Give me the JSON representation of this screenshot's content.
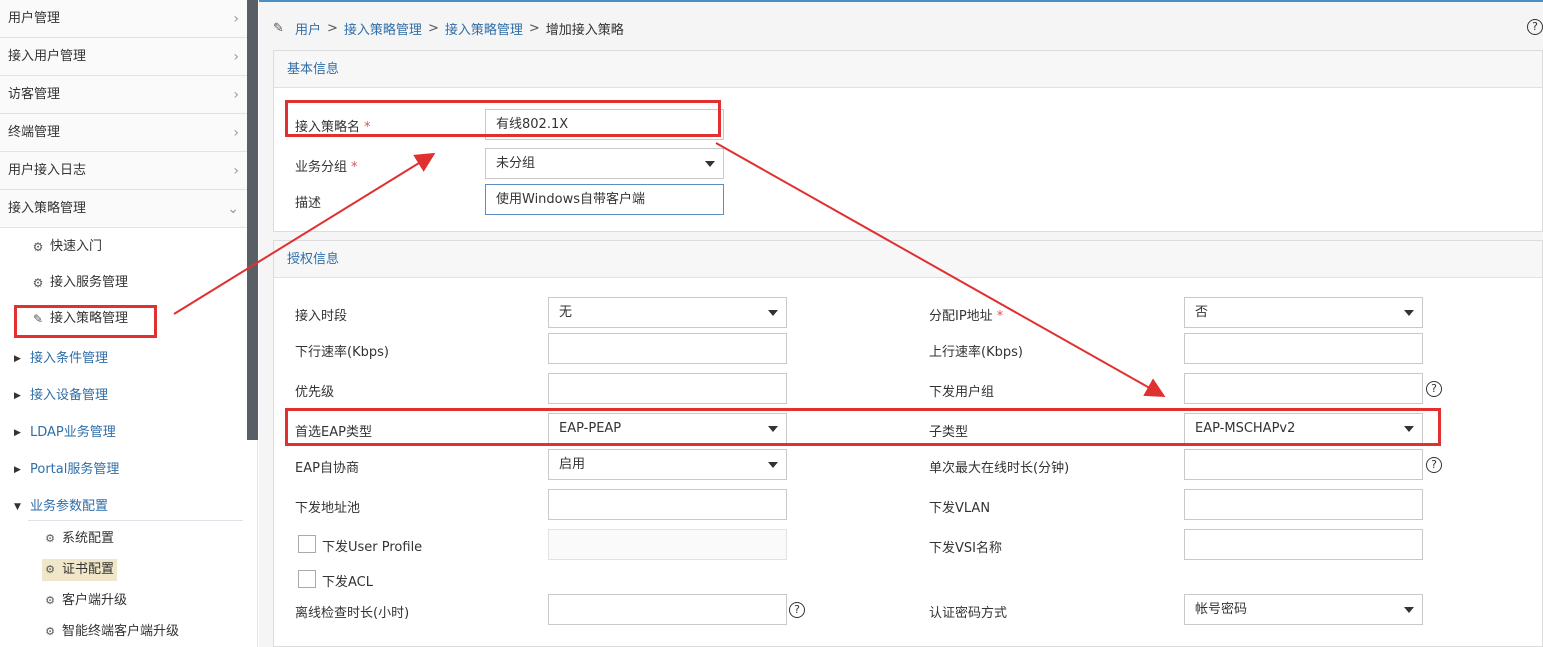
{
  "sidebar": {
    "top_items": [
      {
        "label": "用户管理"
      },
      {
        "label": "接入用户管理"
      },
      {
        "label": "访客管理"
      },
      {
        "label": "终端管理"
      },
      {
        "label": "用户接入日志"
      },
      {
        "label": "接入策略管理"
      }
    ],
    "sub_items": [
      {
        "label": "快速入门"
      },
      {
        "label": "接入服务管理"
      },
      {
        "label": "接入策略管理"
      }
    ],
    "categories": [
      {
        "label": "接入条件管理"
      },
      {
        "label": "接入设备管理"
      },
      {
        "label": "LDAP业务管理"
      },
      {
        "label": "Portal服务管理"
      },
      {
        "label": "业务参数配置"
      }
    ],
    "param_items": [
      {
        "label": "系统配置"
      },
      {
        "label": "证书配置"
      },
      {
        "label": "客户端升级"
      },
      {
        "label": "智能终端客户端升级"
      }
    ]
  },
  "breadcrumb": {
    "items": [
      "用户",
      "接入策略管理",
      "接入策略管理"
    ],
    "current": "增加接入策略",
    "sep": ">"
  },
  "basic": {
    "title": "基本信息",
    "name_label": "接入策略名",
    "name_value": "有线802.1X",
    "group_label": "业务分组",
    "group_value": "未分组",
    "desc_label": "描述",
    "desc_value": "使用Windows自带客户端",
    "required_mark": "*"
  },
  "auth": {
    "title": "授权信息",
    "left": {
      "time_label": "接入时段",
      "time_value": "无",
      "down_rate_label": "下行速率(Kbps)",
      "down_rate_value": "",
      "priority_label": "优先级",
      "priority_value": "",
      "eap_label": "首选EAP类型",
      "eap_value": "EAP-PEAP",
      "eap_nego_label": "EAP自协商",
      "eap_nego_value": "启用",
      "pool_label": "下发地址池",
      "pool_value": "",
      "profile_label": "下发User Profile",
      "profile_value": "",
      "acl_label": "下发ACL",
      "offline_label": "离线检查时长(小时)",
      "offline_value": ""
    },
    "right": {
      "ip_label": "分配IP地址",
      "ip_value": "否",
      "up_rate_label": "上行速率(Kbps)",
      "up_rate_value": "",
      "group_label": "下发用户组",
      "group_value": "",
      "subtype_label": "子类型",
      "subtype_value": "EAP-MSCHAPv2",
      "maxtime_label": "单次最大在线时长(分钟)",
      "maxtime_value": "",
      "vlan_label": "下发VLAN",
      "vlan_value": "",
      "vsi_label": "下发VSI名称",
      "vsi_value": "",
      "pwd_label": "认证密码方式",
      "pwd_value": "帐号密码"
    }
  },
  "colors": {
    "annotation": "#e03030",
    "link": "#2f6ea8"
  },
  "help_glyph": "?",
  "chevron_right": "›",
  "chevron_down": "⌄"
}
